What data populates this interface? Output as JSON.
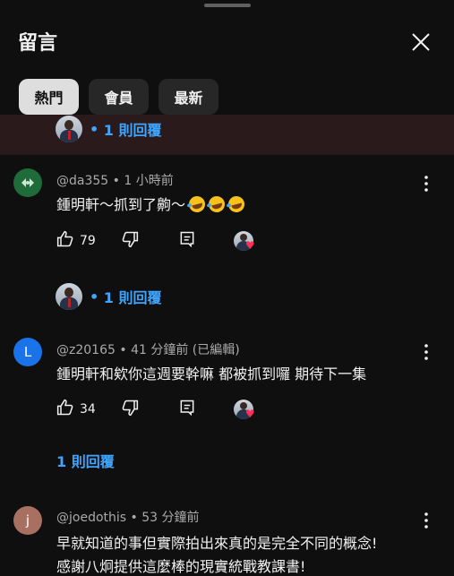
{
  "panel": {
    "title": "留言"
  },
  "tabs": [
    {
      "label": "熱門",
      "active": true
    },
    {
      "label": "會員",
      "active": false
    },
    {
      "label": "最新",
      "active": false
    }
  ],
  "thread_top": {
    "reply_label": "1 則回覆"
  },
  "comments": [
    {
      "handle": "@da355",
      "time": "1 小時前",
      "text": "鍾明軒～抓到了齁～",
      "emoji_count": 3,
      "likes": "79",
      "avatar_color": "#1f6b3a",
      "reply_label": "1 則回覆",
      "creator_hearted": true
    },
    {
      "handle": "@z20165",
      "time": "41 分鐘前 (已編輯)",
      "text": "鍾明軒和欸你這週要幹嘛 都被抓到囉 期待下一集",
      "likes": "34",
      "avatar_letter": "L",
      "avatar_color": "#1a73e8",
      "reply_label": "1 則回覆",
      "creator_hearted": true
    },
    {
      "handle": "@joedothis",
      "time": "53 分鐘前",
      "text_line1": "早就知道的事但實際拍出來真的是完全不同的概念!",
      "text_line2": "感謝八炯提供這麼棒的現實統戰教課書!",
      "avatar_letter": "j",
      "avatar_color": "#a87060"
    }
  ],
  "colors": {
    "background": "#0f0f0f",
    "link": "#3ea6ff",
    "heart": "#ff2d55"
  }
}
